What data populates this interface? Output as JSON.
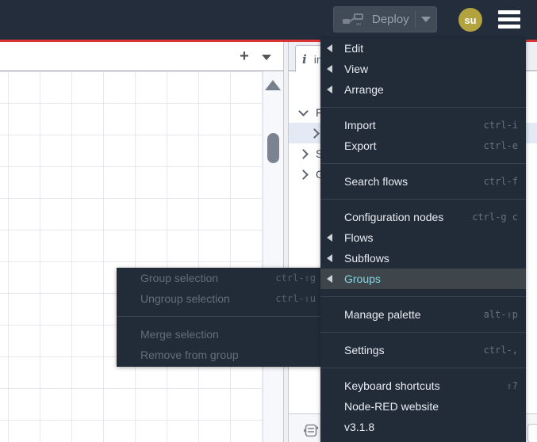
{
  "colors": {
    "accent_red": "#dc3434",
    "menu_bg": "#222c39",
    "menu_highlight_bg": "#3f464b",
    "menu_highlight_text": "#7fd6e2",
    "avatar_bg": "#b2a33f",
    "selected_row_bg": "#e4e9f6"
  },
  "header": {
    "deploy_label": "Deploy",
    "avatar_initials": "su"
  },
  "workspace_tabs": {
    "add_button_glyph": "+"
  },
  "sidebar": {
    "tab": {
      "icon": "info-icon",
      "icon_glyph": "i",
      "label": "in"
    },
    "tree": [
      {
        "caret": "down",
        "label": "Flo",
        "indent": 0,
        "selected": false
      },
      {
        "caret": "right",
        "label": "",
        "indent": 1,
        "selected": true
      },
      {
        "caret": "right",
        "label": "Su",
        "indent": 0,
        "selected": false
      },
      {
        "caret": "right",
        "label": "Glo",
        "indent": 0,
        "selected": false
      }
    ]
  },
  "menu": {
    "items": [
      {
        "type": "item",
        "label": "Edit",
        "submenu_left": true
      },
      {
        "type": "item",
        "label": "View",
        "submenu_left": true
      },
      {
        "type": "item",
        "label": "Arrange",
        "submenu_left": true
      },
      {
        "type": "separator"
      },
      {
        "type": "item",
        "label": "Import",
        "shortcut": "ctrl-i"
      },
      {
        "type": "item",
        "label": "Export",
        "shortcut": "ctrl-e"
      },
      {
        "type": "separator"
      },
      {
        "type": "item",
        "label": "Search flows",
        "shortcut": "ctrl-f"
      },
      {
        "type": "separator"
      },
      {
        "type": "item",
        "label": "Configuration nodes",
        "shortcut": "ctrl-g c"
      },
      {
        "type": "item",
        "label": "Flows",
        "submenu_left": true
      },
      {
        "type": "item",
        "label": "Subflows",
        "submenu_left": true
      },
      {
        "type": "item",
        "label": "Groups",
        "submenu_left": true,
        "highlighted": true
      },
      {
        "type": "separator"
      },
      {
        "type": "item",
        "label": "Manage palette",
        "shortcut": "alt-⇧p"
      },
      {
        "type": "separator"
      },
      {
        "type": "item",
        "label": "Settings",
        "shortcut": "ctrl-,"
      },
      {
        "type": "separator"
      },
      {
        "type": "item",
        "label": "Keyboard shortcuts",
        "shortcut": "⇧?"
      },
      {
        "type": "item",
        "label": "Node-RED website"
      },
      {
        "type": "item",
        "label": "v3.1.8"
      }
    ]
  },
  "submenu": {
    "items": [
      {
        "type": "item",
        "label": "Group selection",
        "shortcut": "ctrl-⇧g",
        "disabled": true
      },
      {
        "type": "item",
        "label": "Ungroup selection",
        "shortcut": "ctrl-⇧u",
        "disabled": true
      },
      {
        "type": "separator"
      },
      {
        "type": "item",
        "label": "Merge selection",
        "disabled": true
      },
      {
        "type": "item",
        "label": "Remove from group",
        "disabled": true
      }
    ]
  }
}
